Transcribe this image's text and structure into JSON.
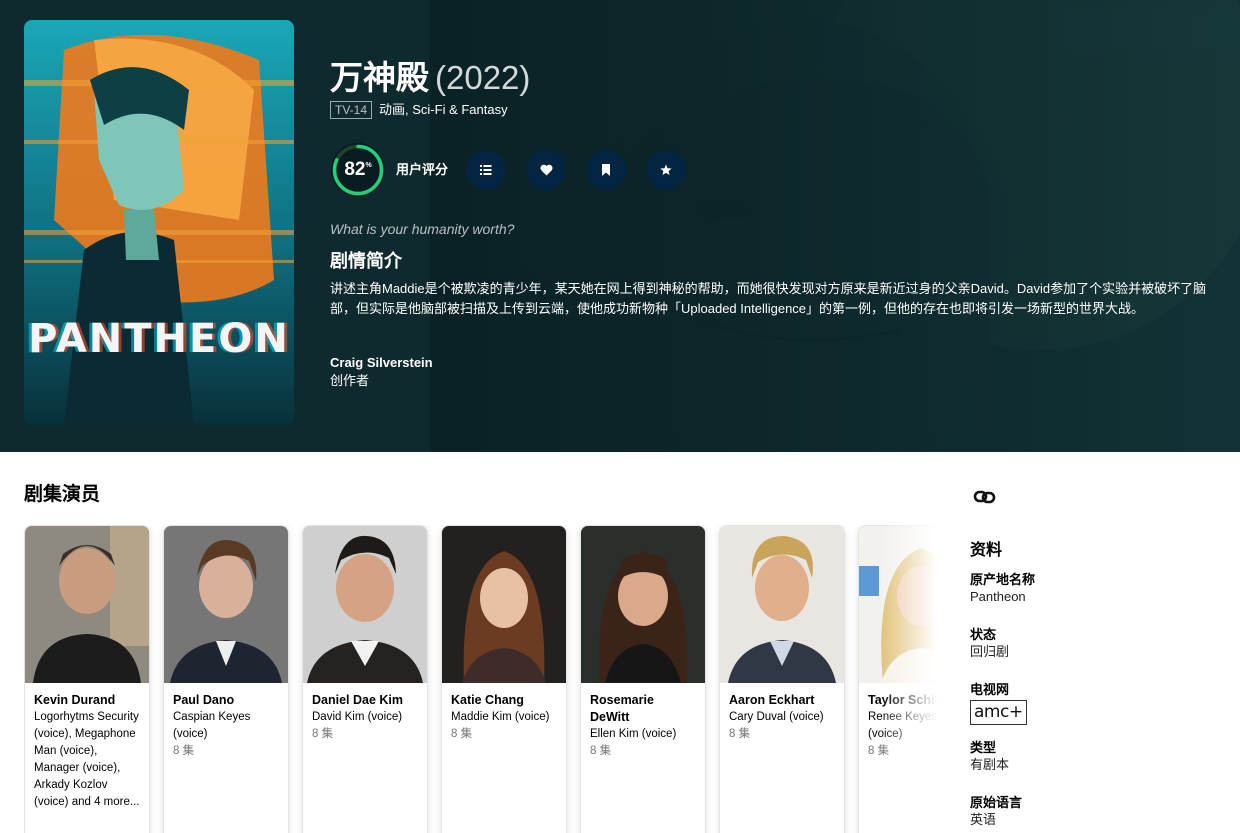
{
  "show": {
    "title": "万神殿",
    "year": "(2022)",
    "certification": "TV-14",
    "genres": "动画, Sci-Fi & Fantasy",
    "score": "82",
    "score_unit": "%",
    "score_fraction": 0.82,
    "score_label": "用户评分",
    "tagline": "What is your humanity worth?",
    "overview_heading": "剧情简介",
    "overview": "讲述主角Maddie是个被欺凌的青少年，某天她在网上得到神秘的帮助，而她很快发现对方原来是新近过身的父亲David。David参加了个实验并被破坏了脑部，但实际是他脑部被扫描及上传到云端，使他成功新物种「Uploaded Intelligence」的第一例，但他的存在也即将引发一场新型的世界大战。",
    "creator_name": "Craig Silverstein",
    "creator_role": "创作者",
    "poster_logo": "PANTHEON"
  },
  "colors": {
    "hero_bg": "#0f2a2e",
    "score_ring": "#21d07a",
    "score_track": "#204529",
    "action_button": "#032541"
  },
  "actions": [
    {
      "name": "add-to-list-button",
      "icon": "list-icon"
    },
    {
      "name": "favorite-button",
      "icon": "heart-icon"
    },
    {
      "name": "watchlist-button",
      "icon": "bookmark-icon"
    },
    {
      "name": "rate-button",
      "icon": "star-icon"
    }
  ],
  "cast_section": {
    "title": "剧集演员",
    "members": [
      {
        "name": "Kevin Durand",
        "character": "Logorhytms Security (voice), Megaphone Man (voice), Manager (voice), Arkady Kozlov (voice) and 4 more...",
        "episodes": ""
      },
      {
        "name": "Paul Dano",
        "character": "Caspian Keyes (voice)",
        "episodes": "8 集"
      },
      {
        "name": "Daniel Dae Kim",
        "character": "David Kim (voice)",
        "episodes": "8 集"
      },
      {
        "name": "Katie Chang",
        "character": "Maddie Kim (voice)",
        "episodes": "8 集"
      },
      {
        "name": "Rosemarie DeWitt",
        "character": "Ellen Kim (voice)",
        "episodes": "8 集"
      },
      {
        "name": "Aaron Eckhart",
        "character": "Cary Duval (voice)",
        "episodes": "8 集"
      },
      {
        "name": "Taylor Schilling",
        "character": "Renee Keyes (voice)",
        "episodes": "8 集"
      }
    ]
  },
  "sidebar": {
    "link_icon": "link-icon",
    "heading": "资料",
    "original_name_label": "原产地名称",
    "original_name": "Pantheon",
    "status_label": "状态",
    "status": "回归剧",
    "network_label": "电视网",
    "network_logo": "amc+",
    "type_label": "类型",
    "type": "有剧本",
    "language_label": "原始语言",
    "language": "英语"
  }
}
